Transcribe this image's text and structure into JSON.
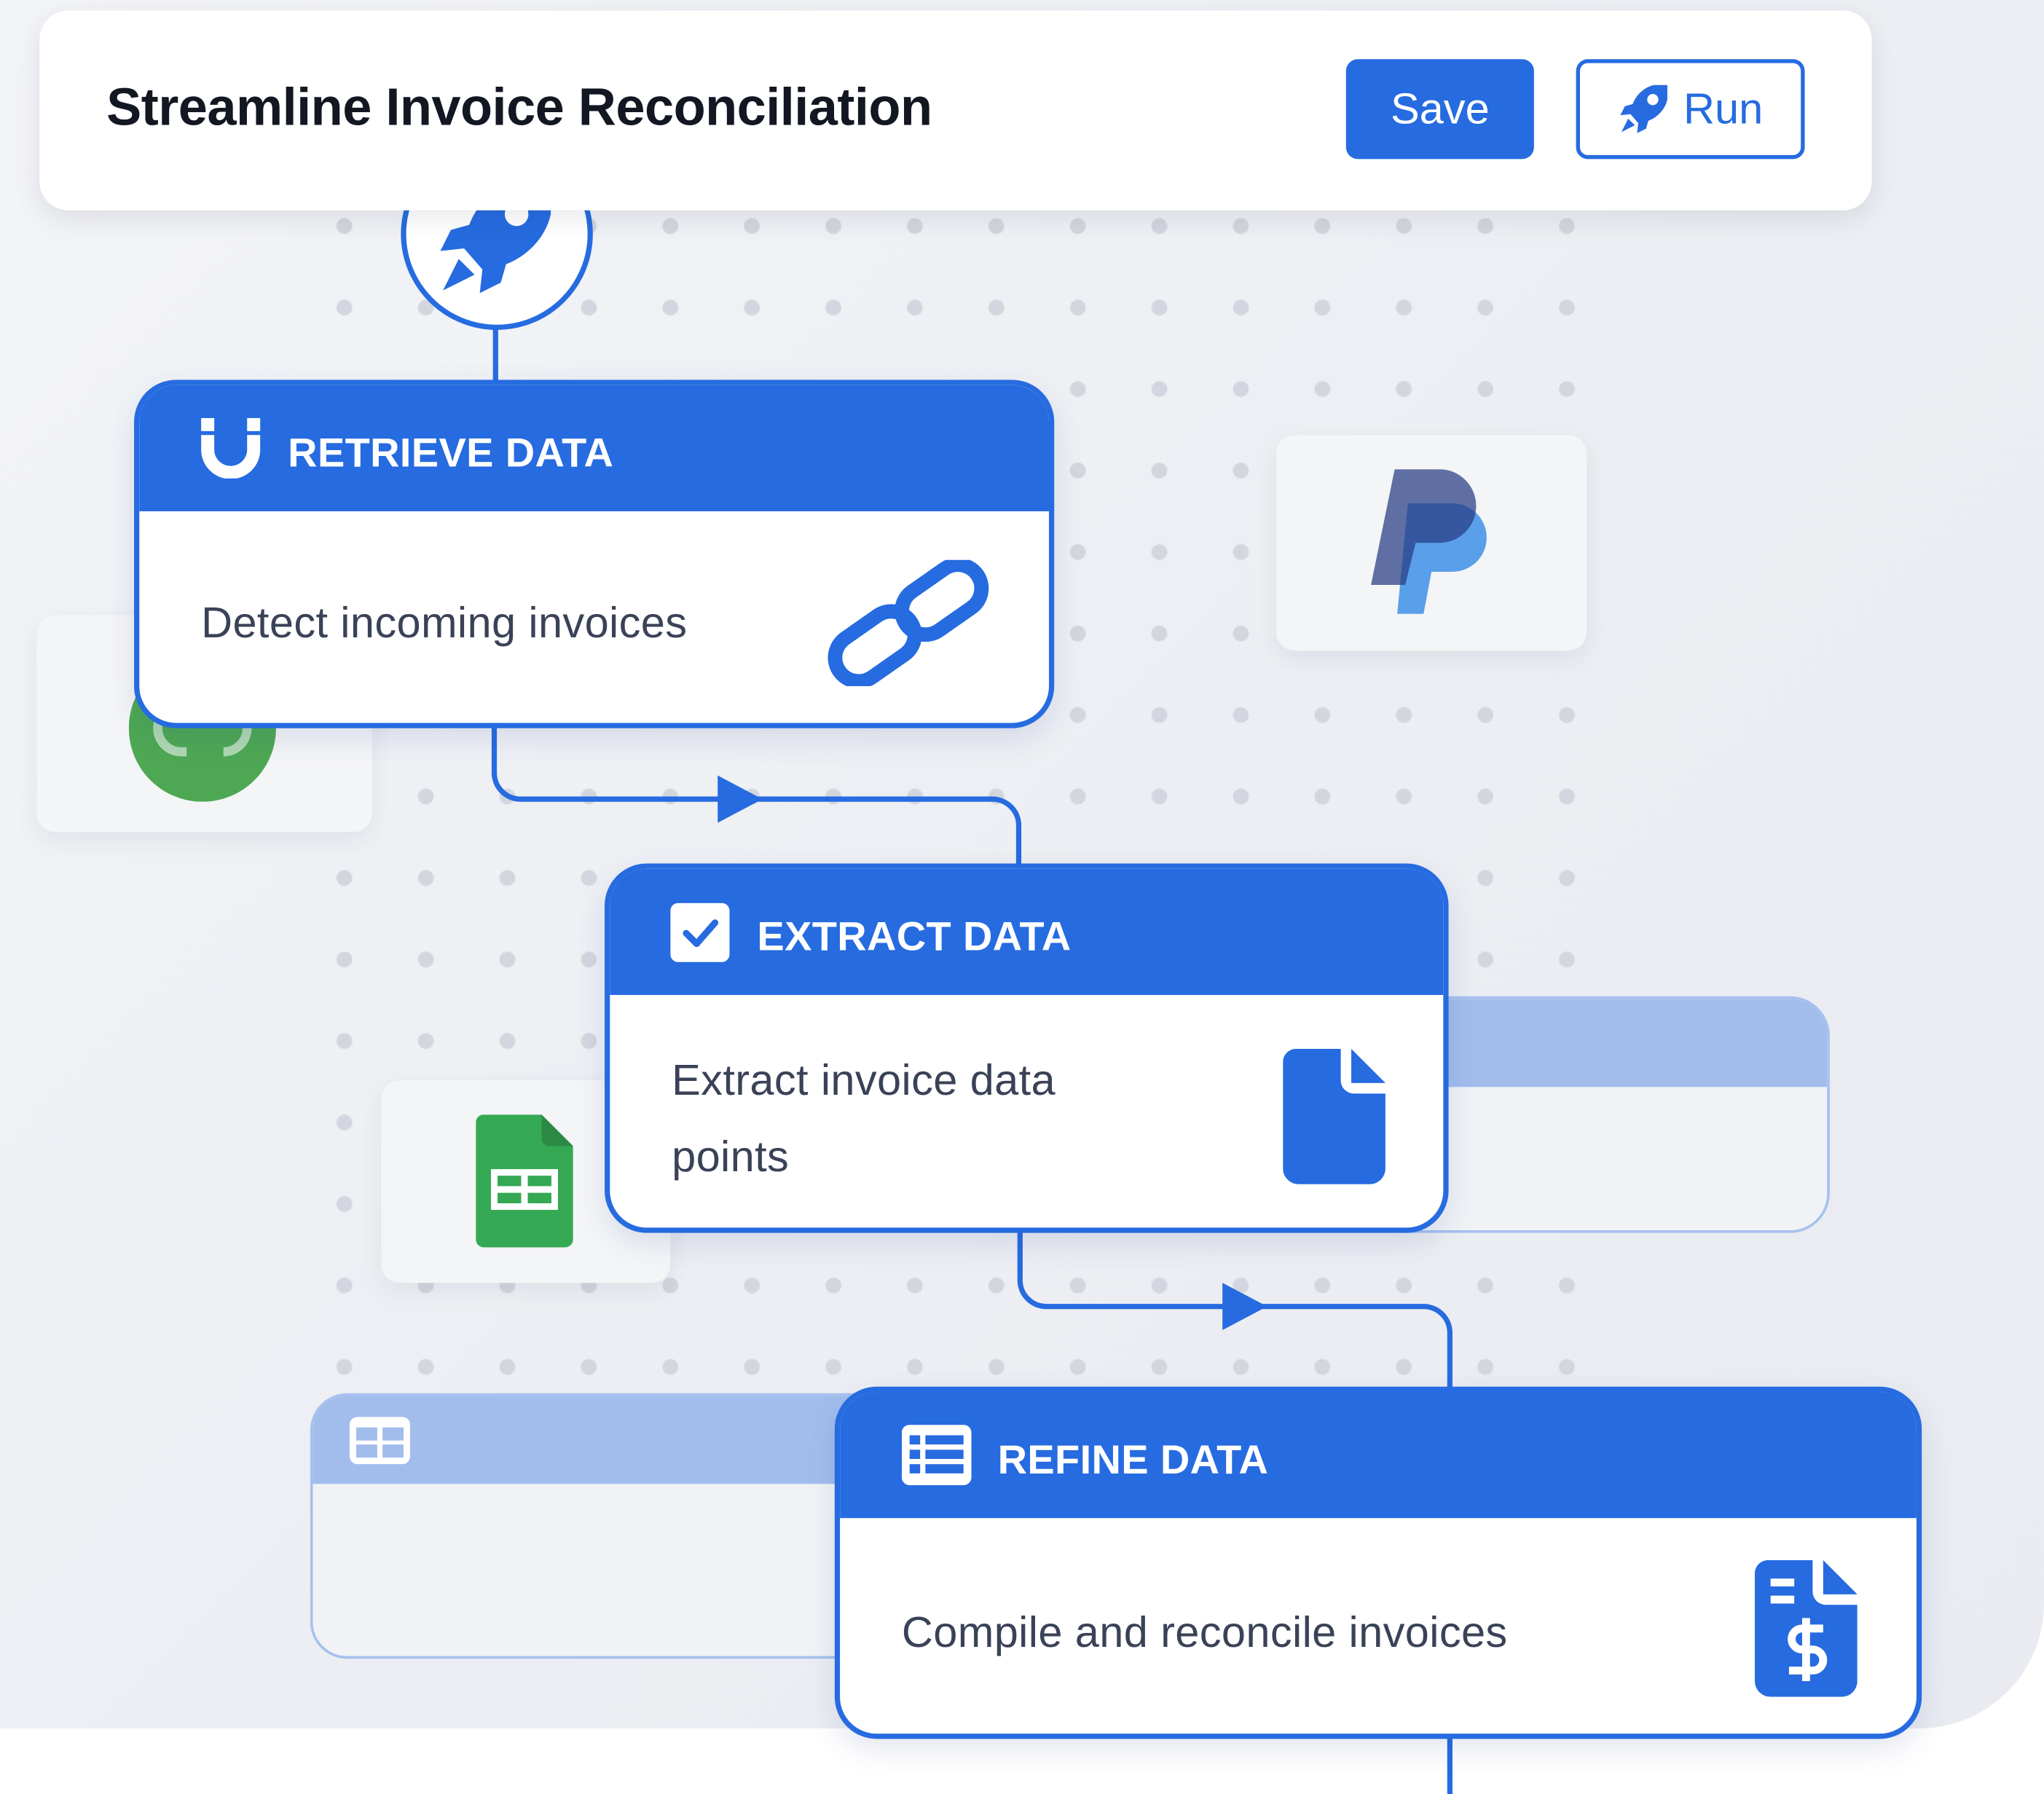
{
  "header": {
    "title": "Streamline Invoice Reconciliation",
    "save_label": "Save",
    "run_label": "Run"
  },
  "nodes": [
    {
      "title": "RETRIEVE DATA",
      "description": "Detect incoming invoices",
      "header_icon": "magnet-icon",
      "body_icon": "link-icon"
    },
    {
      "title": "EXTRACT DATA",
      "description_lines": [
        "Extract invoice data",
        "points"
      ],
      "header_icon": "checkbox-icon",
      "body_icon": "document-icon"
    },
    {
      "title": "REFINE DATA",
      "description": "Compile and reconcile invoices",
      "header_icon": "table-list-icon",
      "body_icon": "invoice-dollar-icon"
    }
  ],
  "integrations": [
    "quickbooks-logo",
    "paypal-logo",
    "google-sheets-logo"
  ],
  "colors": {
    "accent": "#266be0",
    "ghost_band": "#a2bdec",
    "canvas_bg": "#eceef3",
    "paypal_dark": "#273b82",
    "paypal_light": "#2a9be0",
    "quickbooks_green": "#4ea853",
    "sheets_green": "#35a853"
  }
}
